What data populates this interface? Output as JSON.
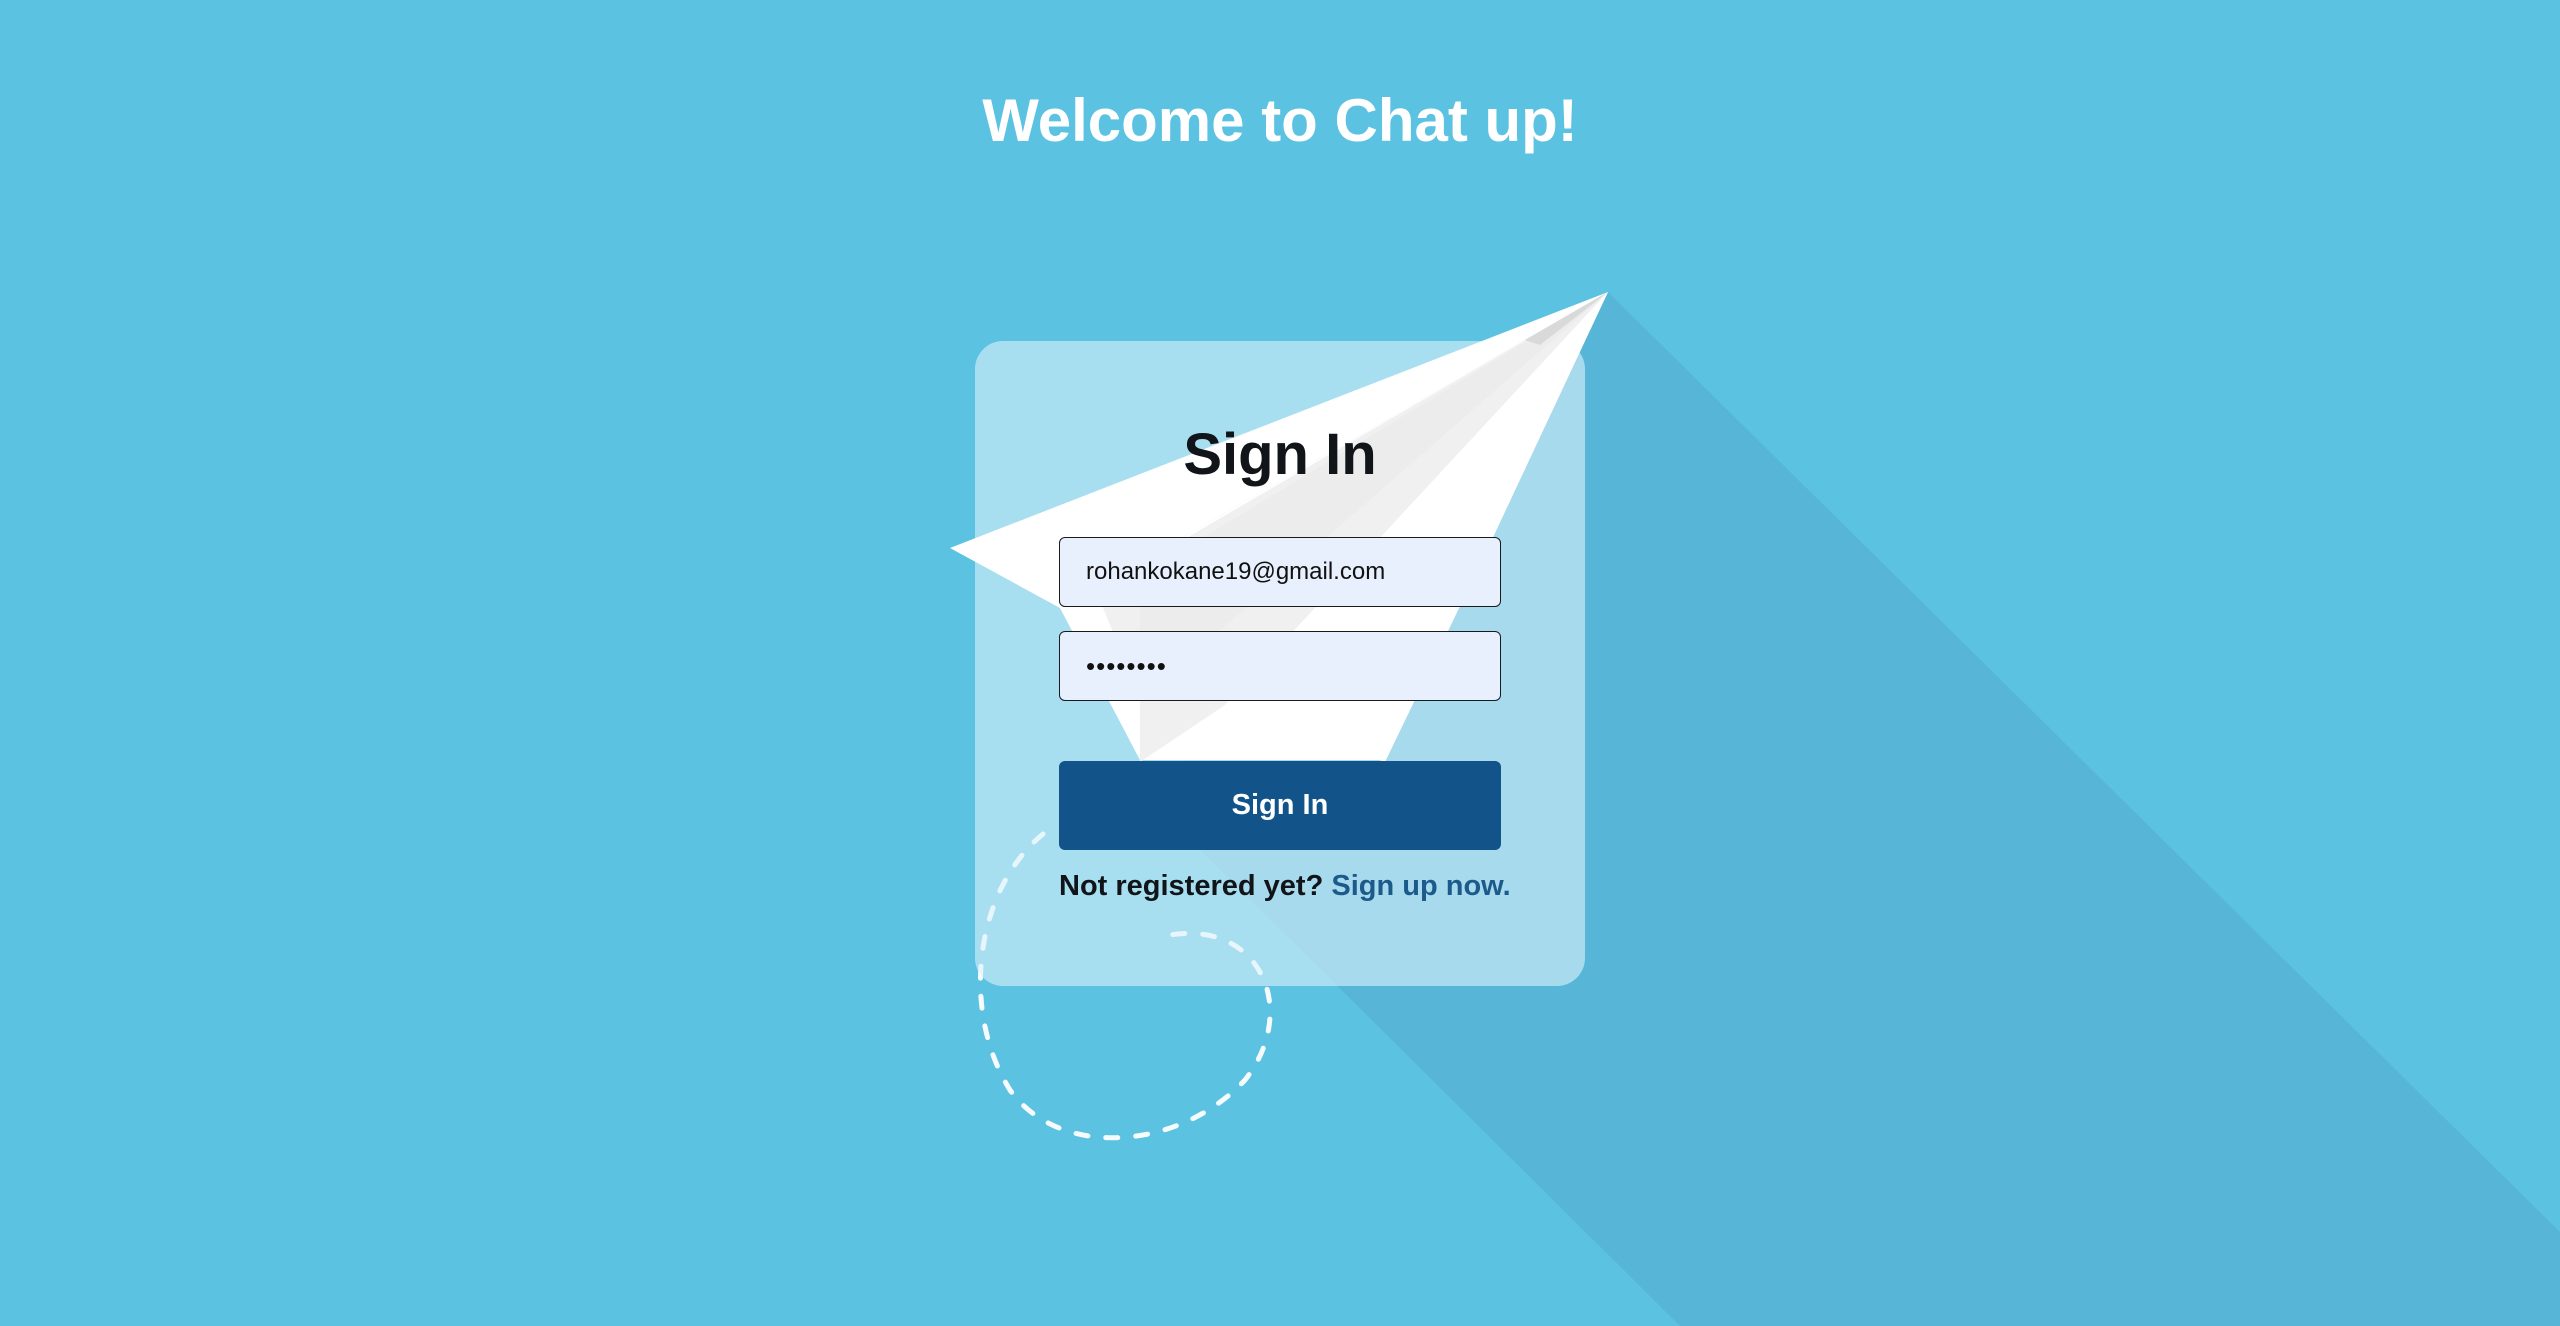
{
  "page": {
    "title": "Welcome to Chat up!"
  },
  "form": {
    "title": "Sign In",
    "email_value": "rohankokane19@gmail.com",
    "password_value": "••••••••",
    "submit_label": "Sign In",
    "signup_prompt": "Not registered yet?",
    "signup_link": "Sign up now."
  },
  "colors": {
    "background": "#5bc2e1",
    "primary_button": "#12548a",
    "link": "#1d5a8c",
    "input_bg": "#e8f0fe"
  },
  "icons": {
    "decoration": "paper-plane-icon"
  }
}
